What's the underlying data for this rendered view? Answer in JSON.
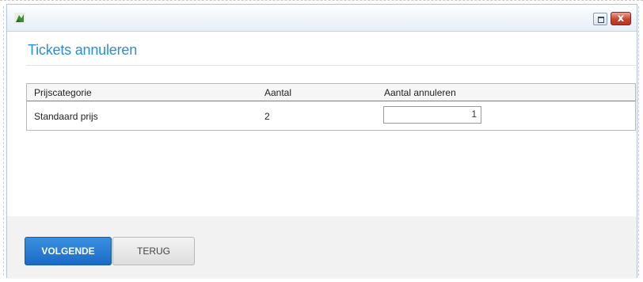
{
  "window": {
    "icon": "app-leaf-icon",
    "controls": {
      "maximize_icon": "maximize-icon",
      "close_label": "x"
    }
  },
  "page": {
    "title": "Tickets annuleren"
  },
  "table": {
    "columns": [
      "Prijscategorie",
      "Aantal",
      "Aantal annuleren"
    ],
    "rows": [
      {
        "category": "Standaard prijs",
        "quantity": "2",
        "cancel_quantity": "1"
      }
    ]
  },
  "footer": {
    "next_label": "VOLGENDE",
    "back_label": "TERUG"
  },
  "colors": {
    "accent": "#2a8fd0",
    "primary_button": "#1b6bc7",
    "close_button": "#c9442f"
  }
}
